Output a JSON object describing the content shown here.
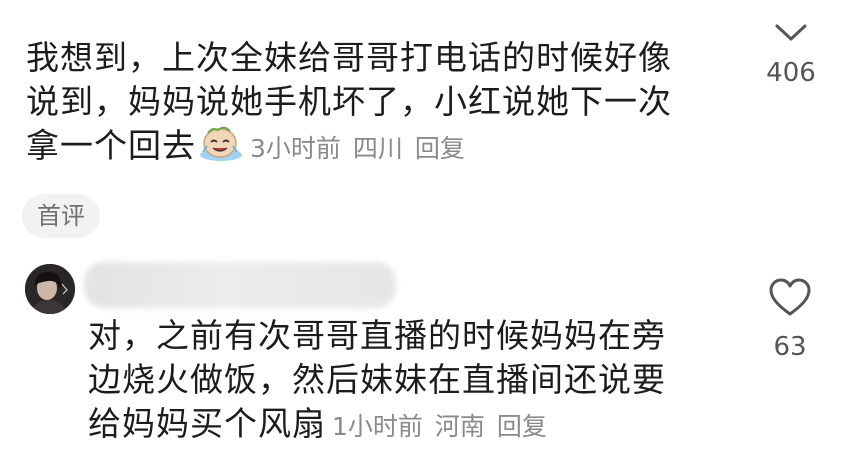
{
  "comment1": {
    "lines": [
      "我想到，上次全妹给哥哥打电话的时候好像",
      "说到，妈妈说她手机坏了，小红说她下一次",
      "拿一个回去"
    ],
    "emoji": "laughing-emoji",
    "time": "3小时前",
    "location": "四川",
    "reply_label": "回复",
    "count": "406",
    "icon": "chevron-down-icon"
  },
  "badge": {
    "label": "首评"
  },
  "comment2": {
    "lines": [
      "对，之前有次哥哥直播的时候妈妈在旁",
      "边烧火做饭，然后妹妹在直播间还说要",
      "给妈妈买个风扇"
    ],
    "time": "1小时前",
    "location": "河南",
    "reply_label": "回复",
    "like_count": "63",
    "icon": "heart-icon"
  }
}
